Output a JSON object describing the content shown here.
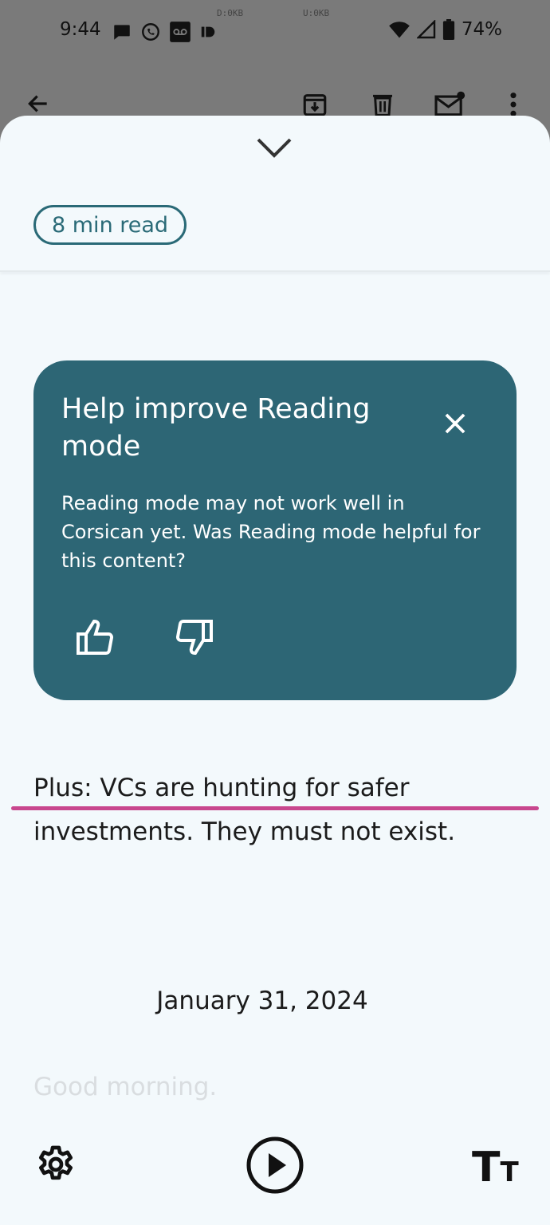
{
  "status_bar": {
    "time": "9:44",
    "down_speed": "D:0KB",
    "up_speed": "U:0KB",
    "battery": "74%"
  },
  "reading_mode": {
    "read_time": "8 min read",
    "feedback_card": {
      "title": "Help improve Reading mode",
      "body": "Reading mode may not work well in Corsican yet. Was Reading mode helpful for this content?"
    },
    "headline": "Plus: VCs are hunting for safer investments. They must not exist.",
    "date": "January 31, 2024",
    "faded_text": "Good morning.",
    "text_size_label_big": "T",
    "text_size_label_small": "T"
  },
  "colors": {
    "card_bg": "#2d6675",
    "accent": "#2a6a77",
    "highlight": "#c8478e"
  }
}
